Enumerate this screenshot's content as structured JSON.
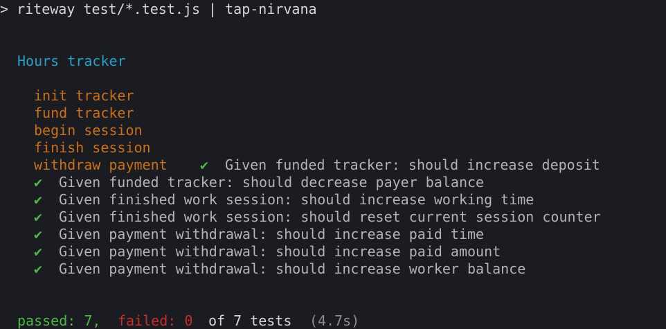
{
  "command": "> riteway test/*.test.js | tap-nirvana",
  "suite_title": "Hours tracker",
  "groups": [
    "init tracker",
    "fund tracker",
    "begin session",
    "finish session",
    "withdraw payment"
  ],
  "check_glyph": "✔",
  "inline_result": "Given funded tracker: should increase deposit",
  "results": [
    "Given funded tracker: should decrease payer balance",
    "Given finished work session: should increase working time",
    "Given finished work session: should reset current session counter",
    "Given payment withdrawal: should increase paid time",
    "Given payment withdrawal: should increase paid amount",
    "Given payment withdrawal: should increase worker balance"
  ],
  "summary": {
    "passed": "passed: 7,",
    "failed": "failed: 0",
    "total": "of 7 tests",
    "duration": "(4.7s)"
  },
  "colors": {
    "background": "#1b1c21",
    "suite": "#2a9fc4",
    "group": "#c9701c",
    "pass": "#4fb546",
    "fail": "#cc2b2b",
    "text": "#b3b3b3"
  }
}
